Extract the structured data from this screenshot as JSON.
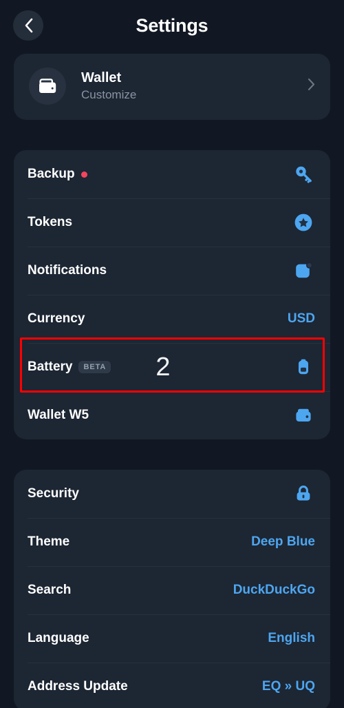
{
  "header": {
    "title": "Settings",
    "back_icon": "chevron-left-icon"
  },
  "wallet_card": {
    "icon": "wallet-icon",
    "title": "Wallet",
    "subtitle": "Customize",
    "chevron_icon": "chevron-right-icon"
  },
  "colors": {
    "page_background": "#111823",
    "card_background": "#1d2633",
    "accent_blue": "#4da6f0",
    "badge_red": "#f5445f",
    "annotation_red": "#fe0000",
    "label_white": "#ffffff",
    "subtext_grey": "#8a94a3"
  },
  "group_main": {
    "rows": [
      {
        "label": "Backup",
        "badge_dot": true,
        "value": "",
        "icon": "key-icon"
      },
      {
        "label": "Tokens",
        "badge_dot": false,
        "value": "",
        "icon": "star-circle-icon"
      },
      {
        "label": "Notifications",
        "badge_dot": false,
        "value": "",
        "icon": "notification-square-icon"
      },
      {
        "label": "Currency",
        "badge_dot": false,
        "value": "USD",
        "icon": ""
      },
      {
        "label": "Battery",
        "badge_dot": false,
        "tag": "BETA",
        "count": "2",
        "value": "",
        "icon": "battery-icon"
      },
      {
        "label": "Wallet W5",
        "badge_dot": false,
        "value": "",
        "icon": "wallet-small-icon"
      }
    ]
  },
  "group_secondary": {
    "rows": [
      {
        "label": "Security",
        "value": "",
        "icon": "lock-icon"
      },
      {
        "label": "Theme",
        "value": "Deep Blue",
        "icon": ""
      },
      {
        "label": "Search",
        "value": "DuckDuckGo",
        "icon": ""
      },
      {
        "label": "Language",
        "value": "English",
        "icon": ""
      },
      {
        "label": "Address Update",
        "value": "EQ » UQ",
        "icon": ""
      }
    ]
  }
}
